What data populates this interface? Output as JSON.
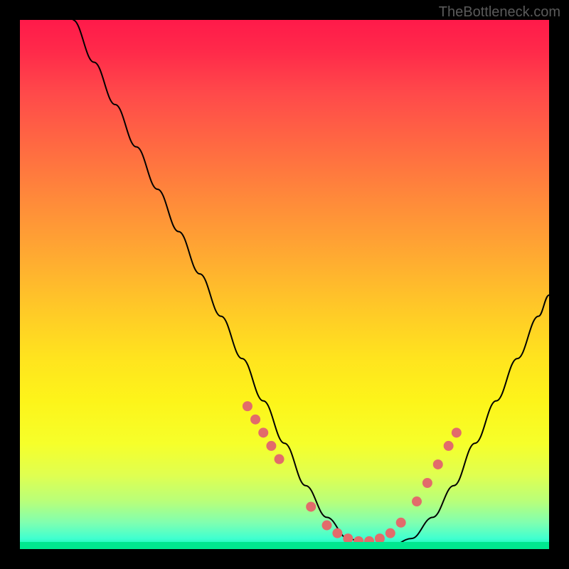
{
  "watermark": "TheBottleneck.com",
  "chart_data": {
    "type": "line",
    "title": "",
    "xlabel": "",
    "ylabel": "",
    "xlim": [
      0,
      100
    ],
    "ylim": [
      0,
      100
    ],
    "series": [
      {
        "name": "curve",
        "x": [
          10,
          14,
          18,
          22,
          26,
          30,
          34,
          38,
          42,
          46,
          50,
          54,
          58,
          62,
          66,
          70,
          74,
          78,
          82,
          86,
          90,
          94,
          98,
          100
        ],
        "y": [
          100,
          92,
          84,
          76,
          68,
          60,
          52,
          44,
          36,
          28,
          20,
          12,
          6,
          2,
          0.5,
          0.5,
          2,
          6,
          12,
          20,
          28,
          36,
          44,
          48
        ]
      }
    ],
    "markers": {
      "name": "highlight-points",
      "x": [
        43,
        44.5,
        46,
        47.5,
        49,
        55,
        58,
        60,
        62,
        64,
        66,
        68,
        70,
        72,
        75,
        77,
        79,
        81,
        82.5
      ],
      "y": [
        27,
        24.5,
        22,
        19.5,
        17,
        8,
        4.5,
        3,
        2,
        1.5,
        1.5,
        2,
        3,
        5,
        9,
        12.5,
        16,
        19.5,
        22
      ]
    },
    "colors": {
      "curve": "#000000",
      "markers": "#e26b6b",
      "gradient_top": "#ff1a4a",
      "gradient_bottom": "#00e88f"
    }
  }
}
